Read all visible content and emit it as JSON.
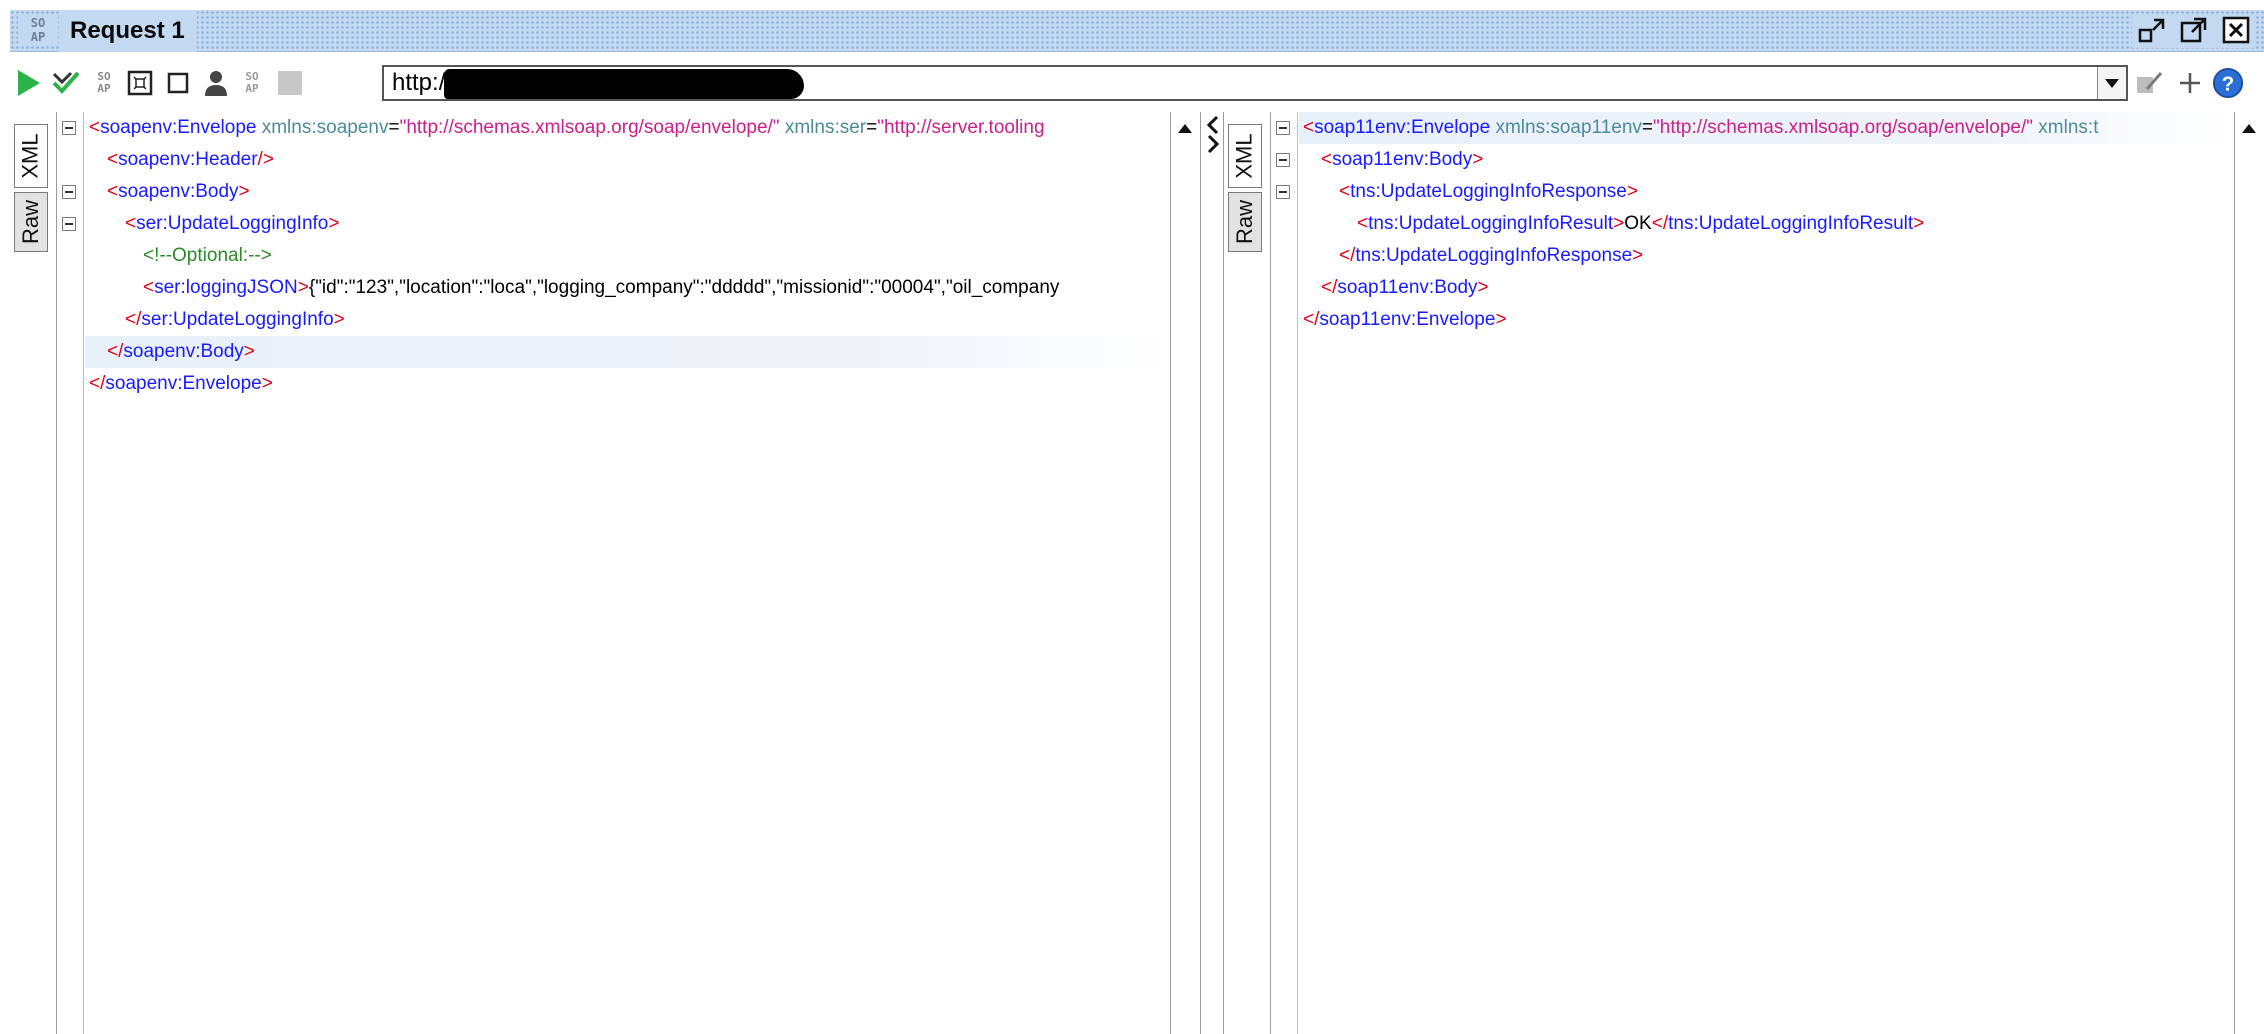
{
  "window": {
    "logo_top": "SO",
    "logo_bottom": "AP",
    "title": "Request 1"
  },
  "toolbar": {
    "url_value": "http://"
  },
  "request": {
    "tabs": [
      {
        "label": "XML"
      },
      {
        "label": "Raw"
      }
    ],
    "lines": [
      {
        "fold": true,
        "indent": 0,
        "parts": [
          [
            "b",
            "<"
          ],
          [
            "t",
            "soapenv:Envelope"
          ],
          [
            "tx",
            " "
          ],
          [
            "an",
            "xmlns:soapenv"
          ],
          [
            "tx",
            "="
          ],
          [
            "av",
            "\"http://schemas.xmlsoap.org/soap/envelope/\""
          ],
          [
            "tx",
            " "
          ],
          [
            "an",
            "xmlns:ser"
          ],
          [
            "tx",
            "="
          ],
          [
            "av",
            "\"http://server.tooling"
          ]
        ]
      },
      {
        "fold": false,
        "indent": 1,
        "parts": [
          [
            "b",
            "<"
          ],
          [
            "t",
            "soapenv:Header"
          ],
          [
            "b",
            "/>"
          ]
        ]
      },
      {
        "fold": true,
        "indent": 1,
        "parts": [
          [
            "b",
            "<"
          ],
          [
            "t",
            "soapenv:Body"
          ],
          [
            "b",
            ">"
          ]
        ]
      },
      {
        "fold": true,
        "indent": 2,
        "parts": [
          [
            "b",
            "<"
          ],
          [
            "t",
            "ser:UpdateLoggingInfo"
          ],
          [
            "b",
            ">"
          ]
        ]
      },
      {
        "fold": false,
        "indent": 3,
        "parts": [
          [
            "cm",
            "<!--Optional:-->"
          ]
        ]
      },
      {
        "fold": false,
        "indent": 3,
        "parts": [
          [
            "b",
            "<"
          ],
          [
            "t",
            "ser:loggingJSON"
          ],
          [
            "b",
            ">"
          ],
          [
            "tx",
            "{\"id\":\"123\",\"location\":\"loca\",\"logging_company\":\"ddddd\",\"missionid\":\"00004\",\"oil_company"
          ]
        ]
      },
      {
        "fold": false,
        "indent": 2,
        "parts": [
          [
            "b",
            "</"
          ],
          [
            "t",
            "ser:UpdateLoggingInfo"
          ],
          [
            "b",
            ">"
          ]
        ]
      },
      {
        "fold": false,
        "indent": 1,
        "highlight": true,
        "parts": [
          [
            "b",
            "</"
          ],
          [
            "t",
            "soapenv:Body"
          ],
          [
            "b",
            ">"
          ]
        ]
      },
      {
        "fold": false,
        "indent": 0,
        "parts": [
          [
            "b",
            "</"
          ],
          [
            "t",
            "soapenv:Envelope"
          ],
          [
            "b",
            ">"
          ]
        ]
      }
    ]
  },
  "response": {
    "tabs": [
      {
        "label": "XML"
      },
      {
        "label": "Raw"
      }
    ],
    "lines": [
      {
        "fold": true,
        "indent": 0,
        "highlight": true,
        "parts": [
          [
            "b",
            "<"
          ],
          [
            "t",
            "soap11env:Envelope"
          ],
          [
            "tx",
            " "
          ],
          [
            "an",
            "xmlns:soap11env"
          ],
          [
            "tx",
            "="
          ],
          [
            "av",
            "\"http://schemas.xmlsoap.org/soap/envelope/\""
          ],
          [
            "tx",
            " "
          ],
          [
            "an",
            "xmlns:t"
          ]
        ]
      },
      {
        "fold": true,
        "indent": 1,
        "parts": [
          [
            "b",
            "<"
          ],
          [
            "t",
            "soap11env:Body"
          ],
          [
            "b",
            ">"
          ]
        ]
      },
      {
        "fold": true,
        "indent": 2,
        "parts": [
          [
            "b",
            "<"
          ],
          [
            "t",
            "tns:UpdateLoggingInfoResponse"
          ],
          [
            "b",
            ">"
          ]
        ]
      },
      {
        "fold": false,
        "indent": 3,
        "parts": [
          [
            "b",
            "<"
          ],
          [
            "t",
            "tns:UpdateLoggingInfoResult"
          ],
          [
            "b",
            ">"
          ],
          [
            "tx",
            "OK"
          ],
          [
            "b",
            "</"
          ],
          [
            "t",
            "tns:UpdateLoggingInfoResult"
          ],
          [
            "b",
            ">"
          ]
        ]
      },
      {
        "fold": false,
        "indent": 2,
        "parts": [
          [
            "b",
            "</"
          ],
          [
            "t",
            "tns:UpdateLoggingInfoResponse"
          ],
          [
            "b",
            ">"
          ]
        ]
      },
      {
        "fold": false,
        "indent": 1,
        "parts": [
          [
            "b",
            "</"
          ],
          [
            "t",
            "soap11env:Body"
          ],
          [
            "b",
            ">"
          ]
        ]
      },
      {
        "fold": false,
        "indent": 0,
        "parts": [
          [
            "b",
            "</"
          ],
          [
            "t",
            "soap11env:Envelope"
          ],
          [
            "b",
            ">"
          ]
        ]
      }
    ]
  },
  "colors": {
    "bracket": "#e2001a",
    "tag": "#1a1aff",
    "attr_name": "#4b8b9c",
    "attr_value": "#c9208b",
    "comment": "#2a8a2a",
    "titlebar": "#c3d9f1",
    "run_green": "#2db34a",
    "help_blue": "#2a6fd6"
  }
}
